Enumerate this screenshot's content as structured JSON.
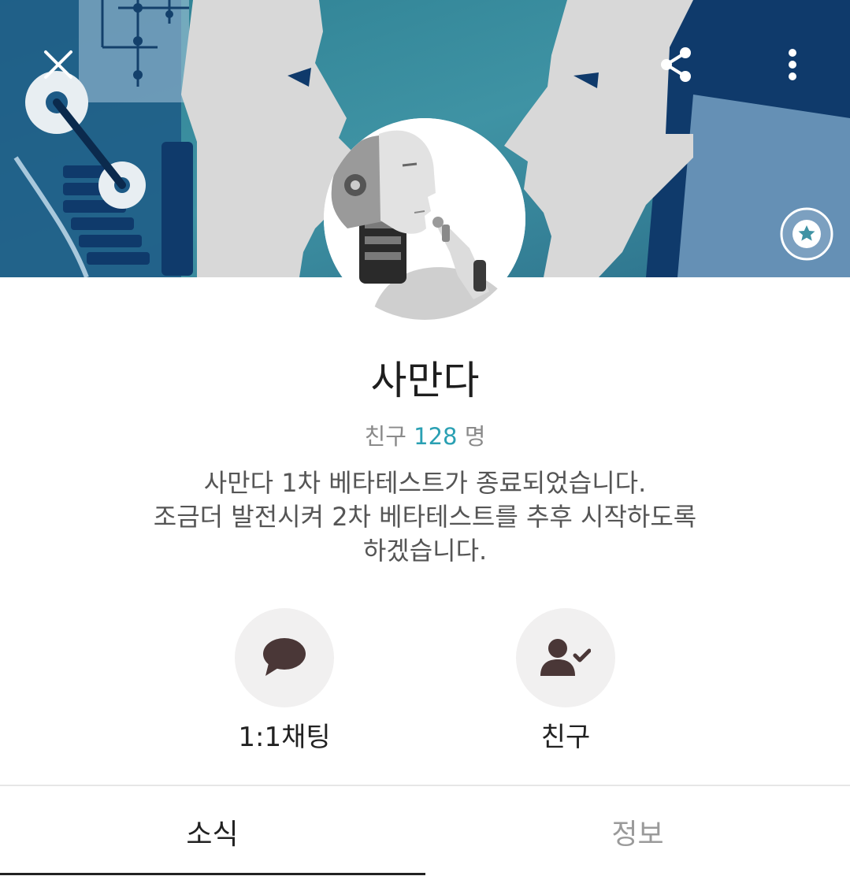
{
  "header": {
    "icons": {
      "close": "close-icon",
      "share": "share-icon",
      "more": "more-vertical-icon",
      "favorite": "star-icon"
    }
  },
  "profile": {
    "name": "사만다",
    "friends_prefix": "친구",
    "friends_count": "128",
    "friends_suffix": "명",
    "status": "사만다 1차 베타테스트가 종료되었습니다.\n조금더 발전시켜 2차 베타테스트를 추후 시작하도록\n하겠습니다."
  },
  "actions": {
    "chat": {
      "label": "1:1채팅",
      "icon": "chat-bubble-icon"
    },
    "friend": {
      "label": "친구",
      "icon": "friend-added-icon"
    }
  },
  "tabs": [
    {
      "label": "소식",
      "active": true
    },
    {
      "label": "정보",
      "active": false
    }
  ],
  "colors": {
    "accent": "#2aa0b3",
    "cover_teal": "#3a8a9c",
    "cover_navy": "#0f3a6b",
    "icon_brown": "#4a3737"
  }
}
